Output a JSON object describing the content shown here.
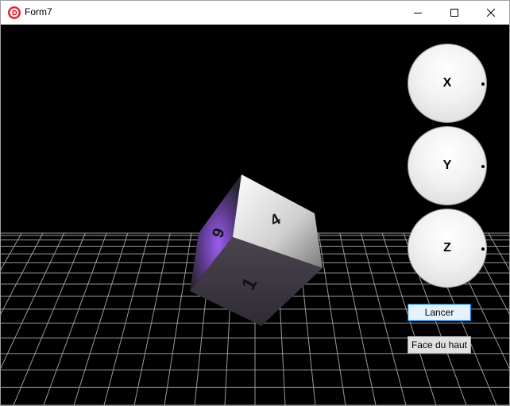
{
  "window": {
    "title": "Form7"
  },
  "titlebar": {
    "icons": [
      "app-icon",
      "minimize-icon",
      "maximize-icon",
      "close-icon"
    ]
  },
  "dice": {
    "visible_faces": {
      "front": "1",
      "left": "6",
      "top": "4"
    },
    "colors": {
      "face_dark": "#3a353e",
      "face_light": "#ffffff",
      "glow": "#8a4fd6"
    }
  },
  "rotation_controls": {
    "x_label": "X",
    "y_label": "Y",
    "z_label": "Z"
  },
  "buttons": {
    "roll": "Lancer",
    "top_face": "Face du haut"
  },
  "colors": {
    "background": "#000000",
    "grid": "#9a9a9a",
    "focus_border": "#0078d7"
  }
}
